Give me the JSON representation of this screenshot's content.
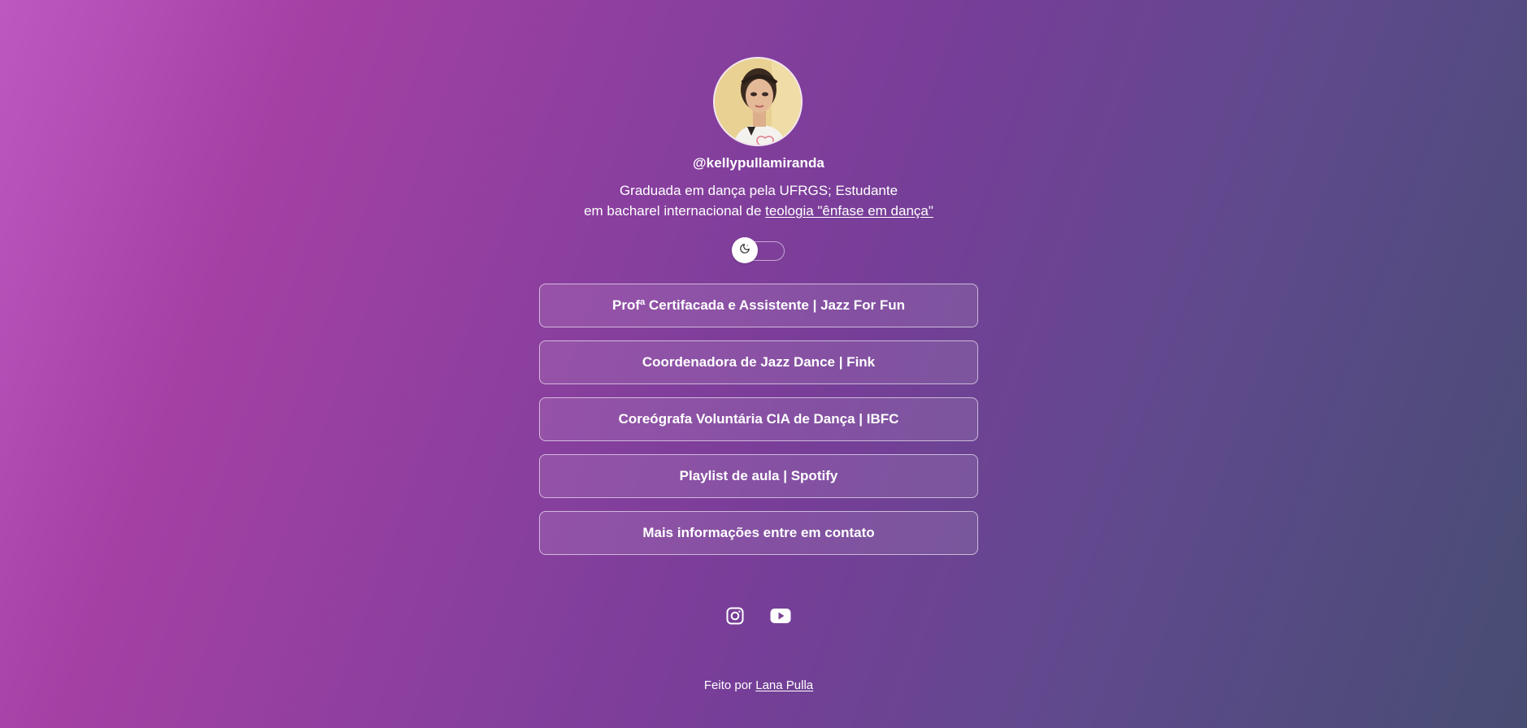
{
  "profile": {
    "username": "@kellypullamiranda",
    "bio_line1": "Graduada em dança pela UFRGS; Estudante",
    "bio_line2_prefix": "em bacharel internacional de ",
    "bio_link": "teologia \"ênfase em dança\""
  },
  "theme_toggle": {
    "icon": "moon-icon"
  },
  "links": [
    {
      "label": "Profª Certifacada e Assistente | Jazz For Fun"
    },
    {
      "label": "Coordenadora de Jazz Dance | Fink"
    },
    {
      "label": "Coreógrafa Voluntária CIA de Dança | IBFC"
    },
    {
      "label": "Playlist de aula | Spotify"
    },
    {
      "label": "Mais informações entre em contato"
    }
  ],
  "socials": [
    {
      "icon": "instagram-icon"
    },
    {
      "icon": "youtube-icon"
    }
  ],
  "footer": {
    "prefix": "Feito por ",
    "author": "Lana Pulla"
  },
  "colors": {
    "gradient_start": "#bc58c0",
    "gradient_mid": "#763e98",
    "gradient_end": "#474c72",
    "text": "#ffffff"
  }
}
